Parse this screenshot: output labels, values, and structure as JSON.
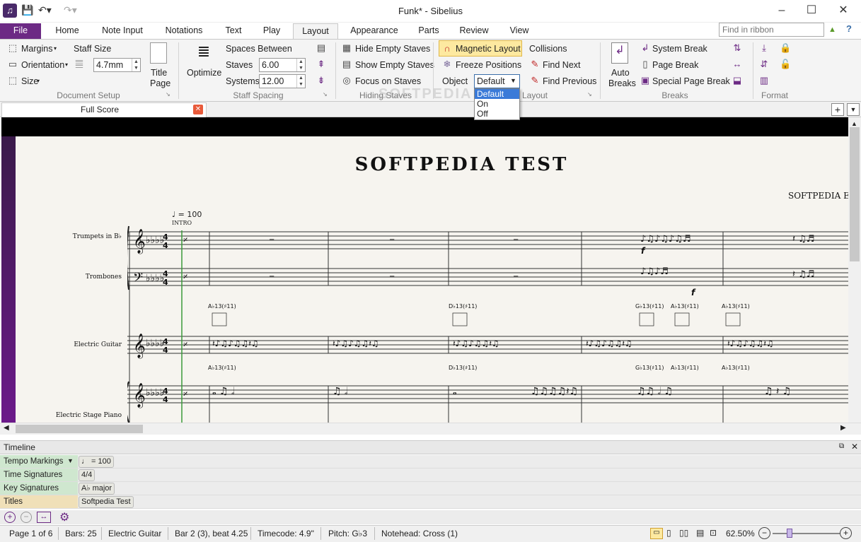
{
  "window": {
    "title": "Funk* - Sibelius"
  },
  "tabs": [
    "File",
    "Home",
    "Note Input",
    "Notations",
    "Text",
    "Play",
    "Layout",
    "Appearance",
    "Parts",
    "Review",
    "View"
  ],
  "active_tab": "Layout",
  "search_placeholder": "Find in ribbon",
  "doc_setup": {
    "margins": "Margins",
    "orientation": "Orientation",
    "size": "Size",
    "staff_size": "Staff Size",
    "staff_size_value": "4.7mm",
    "title_page_1": "Title",
    "title_page_2": "Page",
    "group": "Document Setup"
  },
  "staff_spacing": {
    "optimize": "Optimize",
    "spaces_between": "Spaces Between",
    "staves": "Staves",
    "staves_value": "6.00",
    "systems": "Systems",
    "systems_value": "12.00",
    "group": "Staff Spacing"
  },
  "hiding": {
    "hide": "Hide Empty Staves",
    "show": "Show Empty Staves",
    "focus": "Focus on Staves",
    "group": "Hiding Staves"
  },
  "magnetic": {
    "magnetic": "Magnetic Layout",
    "freeze": "Freeze Positions",
    "object": "Object",
    "object_value": "Default",
    "collisions": "Collisions",
    "next": "Find Next",
    "previous": "Find Previous",
    "group": "Layout",
    "options": [
      "Default",
      "On",
      "Off"
    ]
  },
  "breaks": {
    "auto_1": "Auto",
    "auto_2": "Breaks",
    "system": "System Break",
    "page": "Page Break",
    "special": "Special Page Break",
    "group": "Breaks"
  },
  "format": {
    "group": "Format"
  },
  "doc_tab": "Full Score",
  "score": {
    "title": "SOFTPEDIA TEST",
    "composer": "SOFTPEDIA EDI",
    "tempo": "♩ = 100",
    "intro": "INTRO",
    "staves": [
      "Trumpets in B♭",
      "Trombones",
      "Electric Guitar",
      "Electric Stage Piano"
    ],
    "chords": [
      "A♭13(♯11)",
      "D♭13(♯11)",
      "G♭13(♯11)",
      "A♭13(♯11)",
      "A♭13(♯11)"
    ],
    "dyn": "f"
  },
  "watermark": "SOFTPEDIA",
  "timeline": {
    "title": "Timeline",
    "rows": [
      {
        "label": "Tempo Markings",
        "value": "♩ = 100"
      },
      {
        "label": "Time Signatures",
        "value": "4/4"
      },
      {
        "label": "Key Signatures",
        "value": "A♭ major"
      },
      {
        "label": "Titles",
        "value": "Softpedia Test"
      }
    ]
  },
  "status": {
    "page": "Page 1 of 6",
    "bars": "Bars: 25",
    "instrument": "Electric Guitar",
    "position": "Bar 2 (3), beat 4.25",
    "timecode": "Timecode: 4.9\"",
    "pitch": "Pitch: G♭3",
    "notehead": "Notehead: Cross (1)",
    "zoom": "62.50%"
  }
}
